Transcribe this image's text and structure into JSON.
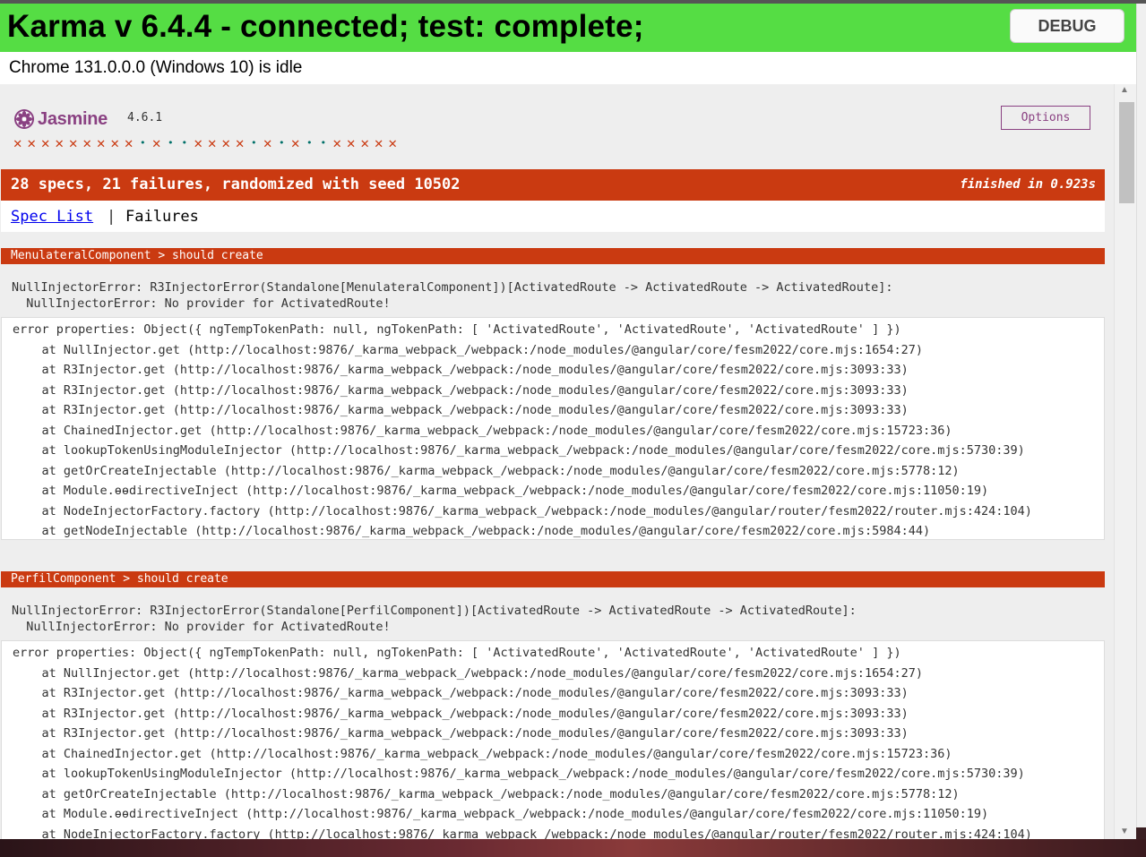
{
  "karma": {
    "title": "Karma v 6.4.4 - connected; test: complete;",
    "debug_label": "DEBUG",
    "browser_status": "Chrome 131.0.0.0 (Windows 10) is idle"
  },
  "jasmine": {
    "logo_text": "Jasmine",
    "version": "4.6.1",
    "options_label": "Options",
    "symbols": [
      "x",
      "x",
      "x",
      "x",
      "x",
      "x",
      "x",
      "x",
      "x",
      "•",
      "x",
      "•",
      "•",
      "x",
      "x",
      "x",
      "x",
      "•",
      "x",
      "•",
      "x",
      "•",
      "•",
      "x",
      "x",
      "x",
      "x",
      "x"
    ],
    "summary": "28 specs, 21 failures, randomized with seed 10502",
    "duration": "finished in 0.923s",
    "menu": {
      "spec_list": "Spec List",
      "separator": "|",
      "failures": "Failures"
    }
  },
  "colors": {
    "karma_green": "#55dd44",
    "failure_red": "#ca3a11",
    "jasmine_purple": "#8a4182",
    "pass_green": "#007069"
  },
  "failures": [
    {
      "header": "MenulateralComponent > should create",
      "message": "NullInjectorError: R3InjectorError(Standalone[MenulateralComponent])[ActivatedRoute -> ActivatedRoute -> ActivatedRoute]:\n  NullInjectorError: No provider for ActivatedRoute!",
      "stack": "error properties: Object({ ngTempTokenPath: null, ngTokenPath: [ 'ActivatedRoute', 'ActivatedRoute', 'ActivatedRoute' ] })\n    at NullInjector.get (http://localhost:9876/_karma_webpack_/webpack:/node_modules/@angular/core/fesm2022/core.mjs:1654:27)\n    at R3Injector.get (http://localhost:9876/_karma_webpack_/webpack:/node_modules/@angular/core/fesm2022/core.mjs:3093:33)\n    at R3Injector.get (http://localhost:9876/_karma_webpack_/webpack:/node_modules/@angular/core/fesm2022/core.mjs:3093:33)\n    at R3Injector.get (http://localhost:9876/_karma_webpack_/webpack:/node_modules/@angular/core/fesm2022/core.mjs:3093:33)\n    at ChainedInjector.get (http://localhost:9876/_karma_webpack_/webpack:/node_modules/@angular/core/fesm2022/core.mjs:15723:36)\n    at lookupTokenUsingModuleInjector (http://localhost:9876/_karma_webpack_/webpack:/node_modules/@angular/core/fesm2022/core.mjs:5730:39)\n    at getOrCreateInjectable (http://localhost:9876/_karma_webpack_/webpack:/node_modules/@angular/core/fesm2022/core.mjs:5778:12)\n    at Module.ɵɵdirectiveInject (http://localhost:9876/_karma_webpack_/webpack:/node_modules/@angular/core/fesm2022/core.mjs:11050:19)\n    at NodeInjectorFactory.factory (http://localhost:9876/_karma_webpack_/webpack:/node_modules/@angular/router/fesm2022/router.mjs:424:104)\n    at getNodeInjectable (http://localhost:9876/_karma_webpack_/webpack:/node_modules/@angular/core/fesm2022/core.mjs:5984:44)"
    },
    {
      "header": "PerfilComponent > should create",
      "message": "NullInjectorError: R3InjectorError(Standalone[PerfilComponent])[ActivatedRoute -> ActivatedRoute -> ActivatedRoute]:\n  NullInjectorError: No provider for ActivatedRoute!",
      "stack": "error properties: Object({ ngTempTokenPath: null, ngTokenPath: [ 'ActivatedRoute', 'ActivatedRoute', 'ActivatedRoute' ] })\n    at NullInjector.get (http://localhost:9876/_karma_webpack_/webpack:/node_modules/@angular/core/fesm2022/core.mjs:1654:27)\n    at R3Injector.get (http://localhost:9876/_karma_webpack_/webpack:/node_modules/@angular/core/fesm2022/core.mjs:3093:33)\n    at R3Injector.get (http://localhost:9876/_karma_webpack_/webpack:/node_modules/@angular/core/fesm2022/core.mjs:3093:33)\n    at R3Injector.get (http://localhost:9876/_karma_webpack_/webpack:/node_modules/@angular/core/fesm2022/core.mjs:3093:33)\n    at ChainedInjector.get (http://localhost:9876/_karma_webpack_/webpack:/node_modules/@angular/core/fesm2022/core.mjs:15723:36)\n    at lookupTokenUsingModuleInjector (http://localhost:9876/_karma_webpack_/webpack:/node_modules/@angular/core/fesm2022/core.mjs:5730:39)\n    at getOrCreateInjectable (http://localhost:9876/_karma_webpack_/webpack:/node_modules/@angular/core/fesm2022/core.mjs:5778:12)\n    at Module.ɵɵdirectiveInject (http://localhost:9876/_karma_webpack_/webpack:/node_modules/@angular/core/fesm2022/core.mjs:11050:19)\n    at NodeInjectorFactory.factory (http://localhost:9876/_karma_webpack_/webpack:/node_modules/@angular/router/fesm2022/router.mjs:424:104)"
    }
  ]
}
